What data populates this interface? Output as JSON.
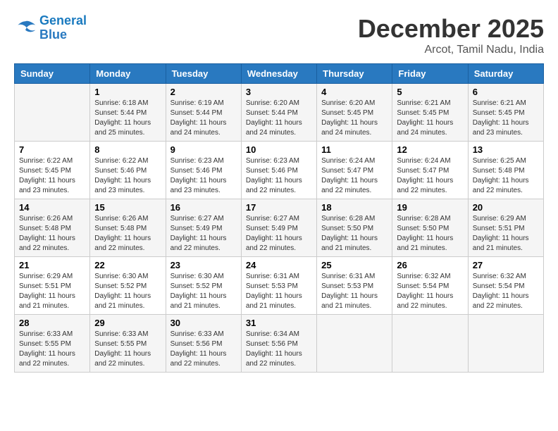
{
  "logo": {
    "line1": "General",
    "line2": "Blue"
  },
  "title": "December 2025",
  "location": "Arcot, Tamil Nadu, India",
  "headers": [
    "Sunday",
    "Monday",
    "Tuesday",
    "Wednesday",
    "Thursday",
    "Friday",
    "Saturday"
  ],
  "weeks": [
    [
      {
        "day": "",
        "sunrise": "",
        "sunset": "",
        "daylight": ""
      },
      {
        "day": "1",
        "sunrise": "Sunrise: 6:18 AM",
        "sunset": "Sunset: 5:44 PM",
        "daylight": "Daylight: 11 hours and 25 minutes."
      },
      {
        "day": "2",
        "sunrise": "Sunrise: 6:19 AM",
        "sunset": "Sunset: 5:44 PM",
        "daylight": "Daylight: 11 hours and 24 minutes."
      },
      {
        "day": "3",
        "sunrise": "Sunrise: 6:20 AM",
        "sunset": "Sunset: 5:44 PM",
        "daylight": "Daylight: 11 hours and 24 minutes."
      },
      {
        "day": "4",
        "sunrise": "Sunrise: 6:20 AM",
        "sunset": "Sunset: 5:45 PM",
        "daylight": "Daylight: 11 hours and 24 minutes."
      },
      {
        "day": "5",
        "sunrise": "Sunrise: 6:21 AM",
        "sunset": "Sunset: 5:45 PM",
        "daylight": "Daylight: 11 hours and 24 minutes."
      },
      {
        "day": "6",
        "sunrise": "Sunrise: 6:21 AM",
        "sunset": "Sunset: 5:45 PM",
        "daylight": "Daylight: 11 hours and 23 minutes."
      }
    ],
    [
      {
        "day": "7",
        "sunrise": "Sunrise: 6:22 AM",
        "sunset": "Sunset: 5:45 PM",
        "daylight": "Daylight: 11 hours and 23 minutes."
      },
      {
        "day": "8",
        "sunrise": "Sunrise: 6:22 AM",
        "sunset": "Sunset: 5:46 PM",
        "daylight": "Daylight: 11 hours and 23 minutes."
      },
      {
        "day": "9",
        "sunrise": "Sunrise: 6:23 AM",
        "sunset": "Sunset: 5:46 PM",
        "daylight": "Daylight: 11 hours and 23 minutes."
      },
      {
        "day": "10",
        "sunrise": "Sunrise: 6:23 AM",
        "sunset": "Sunset: 5:46 PM",
        "daylight": "Daylight: 11 hours and 22 minutes."
      },
      {
        "day": "11",
        "sunrise": "Sunrise: 6:24 AM",
        "sunset": "Sunset: 5:47 PM",
        "daylight": "Daylight: 11 hours and 22 minutes."
      },
      {
        "day": "12",
        "sunrise": "Sunrise: 6:24 AM",
        "sunset": "Sunset: 5:47 PM",
        "daylight": "Daylight: 11 hours and 22 minutes."
      },
      {
        "day": "13",
        "sunrise": "Sunrise: 6:25 AM",
        "sunset": "Sunset: 5:48 PM",
        "daylight": "Daylight: 11 hours and 22 minutes."
      }
    ],
    [
      {
        "day": "14",
        "sunrise": "Sunrise: 6:26 AM",
        "sunset": "Sunset: 5:48 PM",
        "daylight": "Daylight: 11 hours and 22 minutes."
      },
      {
        "day": "15",
        "sunrise": "Sunrise: 6:26 AM",
        "sunset": "Sunset: 5:48 PM",
        "daylight": "Daylight: 11 hours and 22 minutes."
      },
      {
        "day": "16",
        "sunrise": "Sunrise: 6:27 AM",
        "sunset": "Sunset: 5:49 PM",
        "daylight": "Daylight: 11 hours and 22 minutes."
      },
      {
        "day": "17",
        "sunrise": "Sunrise: 6:27 AM",
        "sunset": "Sunset: 5:49 PM",
        "daylight": "Daylight: 11 hours and 22 minutes."
      },
      {
        "day": "18",
        "sunrise": "Sunrise: 6:28 AM",
        "sunset": "Sunset: 5:50 PM",
        "daylight": "Daylight: 11 hours and 21 minutes."
      },
      {
        "day": "19",
        "sunrise": "Sunrise: 6:28 AM",
        "sunset": "Sunset: 5:50 PM",
        "daylight": "Daylight: 11 hours and 21 minutes."
      },
      {
        "day": "20",
        "sunrise": "Sunrise: 6:29 AM",
        "sunset": "Sunset: 5:51 PM",
        "daylight": "Daylight: 11 hours and 21 minutes."
      }
    ],
    [
      {
        "day": "21",
        "sunrise": "Sunrise: 6:29 AM",
        "sunset": "Sunset: 5:51 PM",
        "daylight": "Daylight: 11 hours and 21 minutes."
      },
      {
        "day": "22",
        "sunrise": "Sunrise: 6:30 AM",
        "sunset": "Sunset: 5:52 PM",
        "daylight": "Daylight: 11 hours and 21 minutes."
      },
      {
        "day": "23",
        "sunrise": "Sunrise: 6:30 AM",
        "sunset": "Sunset: 5:52 PM",
        "daylight": "Daylight: 11 hours and 21 minutes."
      },
      {
        "day": "24",
        "sunrise": "Sunrise: 6:31 AM",
        "sunset": "Sunset: 5:53 PM",
        "daylight": "Daylight: 11 hours and 21 minutes."
      },
      {
        "day": "25",
        "sunrise": "Sunrise: 6:31 AM",
        "sunset": "Sunset: 5:53 PM",
        "daylight": "Daylight: 11 hours and 21 minutes."
      },
      {
        "day": "26",
        "sunrise": "Sunrise: 6:32 AM",
        "sunset": "Sunset: 5:54 PM",
        "daylight": "Daylight: 11 hours and 22 minutes."
      },
      {
        "day": "27",
        "sunrise": "Sunrise: 6:32 AM",
        "sunset": "Sunset: 5:54 PM",
        "daylight": "Daylight: 11 hours and 22 minutes."
      }
    ],
    [
      {
        "day": "28",
        "sunrise": "Sunrise: 6:33 AM",
        "sunset": "Sunset: 5:55 PM",
        "daylight": "Daylight: 11 hours and 22 minutes."
      },
      {
        "day": "29",
        "sunrise": "Sunrise: 6:33 AM",
        "sunset": "Sunset: 5:55 PM",
        "daylight": "Daylight: 11 hours and 22 minutes."
      },
      {
        "day": "30",
        "sunrise": "Sunrise: 6:33 AM",
        "sunset": "Sunset: 5:56 PM",
        "daylight": "Daylight: 11 hours and 22 minutes."
      },
      {
        "day": "31",
        "sunrise": "Sunrise: 6:34 AM",
        "sunset": "Sunset: 5:56 PM",
        "daylight": "Daylight: 11 hours and 22 minutes."
      },
      {
        "day": "",
        "sunrise": "",
        "sunset": "",
        "daylight": ""
      },
      {
        "day": "",
        "sunrise": "",
        "sunset": "",
        "daylight": ""
      },
      {
        "day": "",
        "sunrise": "",
        "sunset": "",
        "daylight": ""
      }
    ]
  ]
}
